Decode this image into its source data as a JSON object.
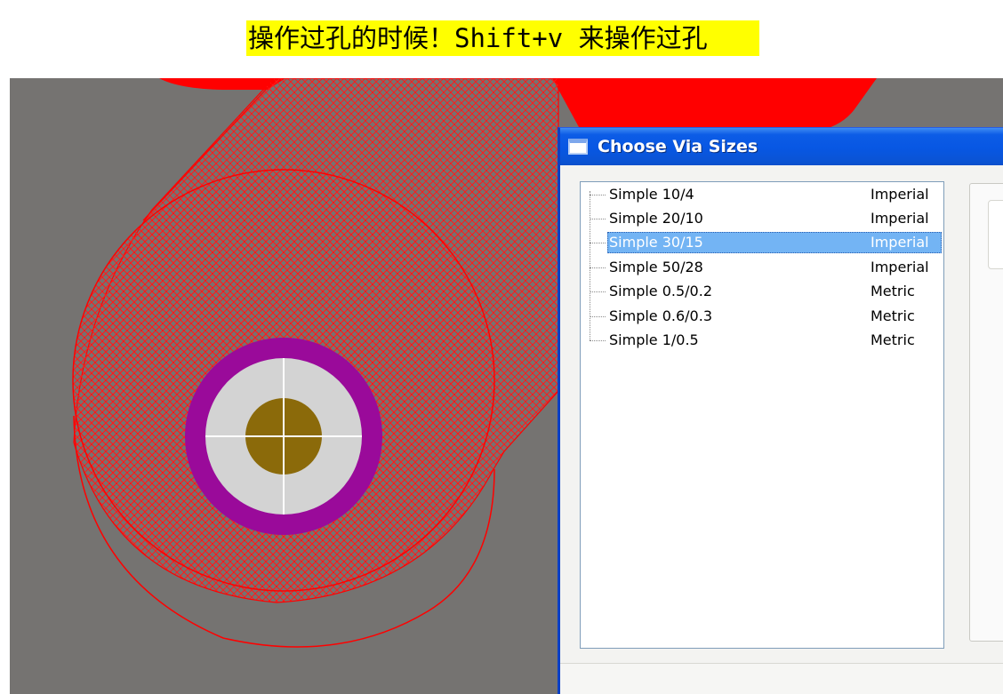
{
  "caption": {
    "text": "操作过孔的时候！Shift+v 来操作过孔",
    "background": "#ffff00"
  },
  "pcb": {
    "copper_color": "#ff0000",
    "pad_ring_color": "#990099",
    "pad_face_color": "#d4d4d4",
    "drill_color": "#8b6a0a",
    "background_color": "#757371"
  },
  "dialog": {
    "title": "Choose Via Sizes",
    "icon": "window-icon",
    "via_sizes": [
      {
        "name": "Simple 10/4",
        "units": "Imperial",
        "selected": false
      },
      {
        "name": "Simple 20/10",
        "units": "Imperial",
        "selected": false
      },
      {
        "name": "Simple 30/15",
        "units": "Imperial",
        "selected": true
      },
      {
        "name": "Simple 50/28",
        "units": "Imperial",
        "selected": false
      },
      {
        "name": "Simple 0.5/0.2",
        "units": "Metric",
        "selected": false
      },
      {
        "name": "Simple 0.6/0.3",
        "units": "Metric",
        "selected": false
      },
      {
        "name": "Simple 1/0.5",
        "units": "Metric",
        "selected": false
      }
    ],
    "selection_color": "#73b4f4"
  }
}
